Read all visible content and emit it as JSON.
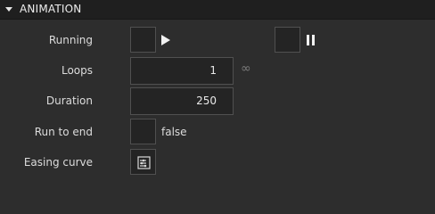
{
  "section": {
    "title": "ANIMATION"
  },
  "rows": {
    "running": {
      "label": "Running"
    },
    "loops": {
      "label": "Loops",
      "value": "1"
    },
    "duration": {
      "label": "Duration",
      "value": "250"
    },
    "run_to_end": {
      "label": "Run to end",
      "value": "false"
    },
    "easing": {
      "label": "Easing curve"
    }
  },
  "icons": {
    "play": "play-icon",
    "pause": "pause-icon",
    "infinity": "infinity-icon",
    "easing": "easing-curve-icon"
  },
  "colors": {
    "background": "#2d2d2d",
    "header": "#1f1f1f",
    "field": "#242424",
    "border": "#505050"
  }
}
